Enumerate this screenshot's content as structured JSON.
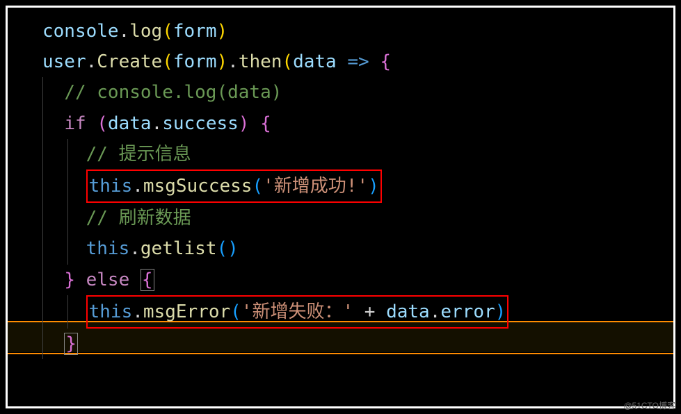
{
  "code": {
    "line1": {
      "obj": "console",
      "dot1": ".",
      "method": "log",
      "paren1": "(",
      "arg": "form",
      "paren2": ")"
    },
    "line2": {
      "obj": "user",
      "dot1": ".",
      "method1": "Create",
      "paren1": "(",
      "arg": "form",
      "paren2": ")",
      "dot2": ".",
      "method2": "then",
      "paren3": "(",
      "param": "data",
      "arrow": " => ",
      "brace": "{"
    },
    "line3": {
      "comment": "// console.log(data)"
    },
    "line4": {
      "keyword": "if",
      "paren1": " (",
      "obj": "data",
      "dot": ".",
      "prop": "success",
      "paren2": ") ",
      "brace": "{"
    },
    "line5": {
      "comment": "// 提示信息"
    },
    "line6": {
      "this": "this",
      "dot": ".",
      "method": "msgSuccess",
      "paren1": "(",
      "string": "'新增成功!'",
      "paren2": ")"
    },
    "line7": {
      "comment": "// 刷新数据"
    },
    "line8": {
      "this": "this",
      "dot": ".",
      "method": "getlist",
      "paren1": "(",
      "paren2": ")"
    },
    "line9": {
      "brace1": "}",
      "keyword": " else ",
      "brace2": "{"
    },
    "line10": {
      "this": "this",
      "dot1": ".",
      "method": "msgError",
      "paren1": "(",
      "string": "'新增失败：'",
      "op": " + ",
      "obj": "data",
      "dot2": ".",
      "prop": "error",
      "paren2": ")"
    },
    "line11": {
      "brace": "}"
    }
  },
  "watermark": "@51CTO博客"
}
